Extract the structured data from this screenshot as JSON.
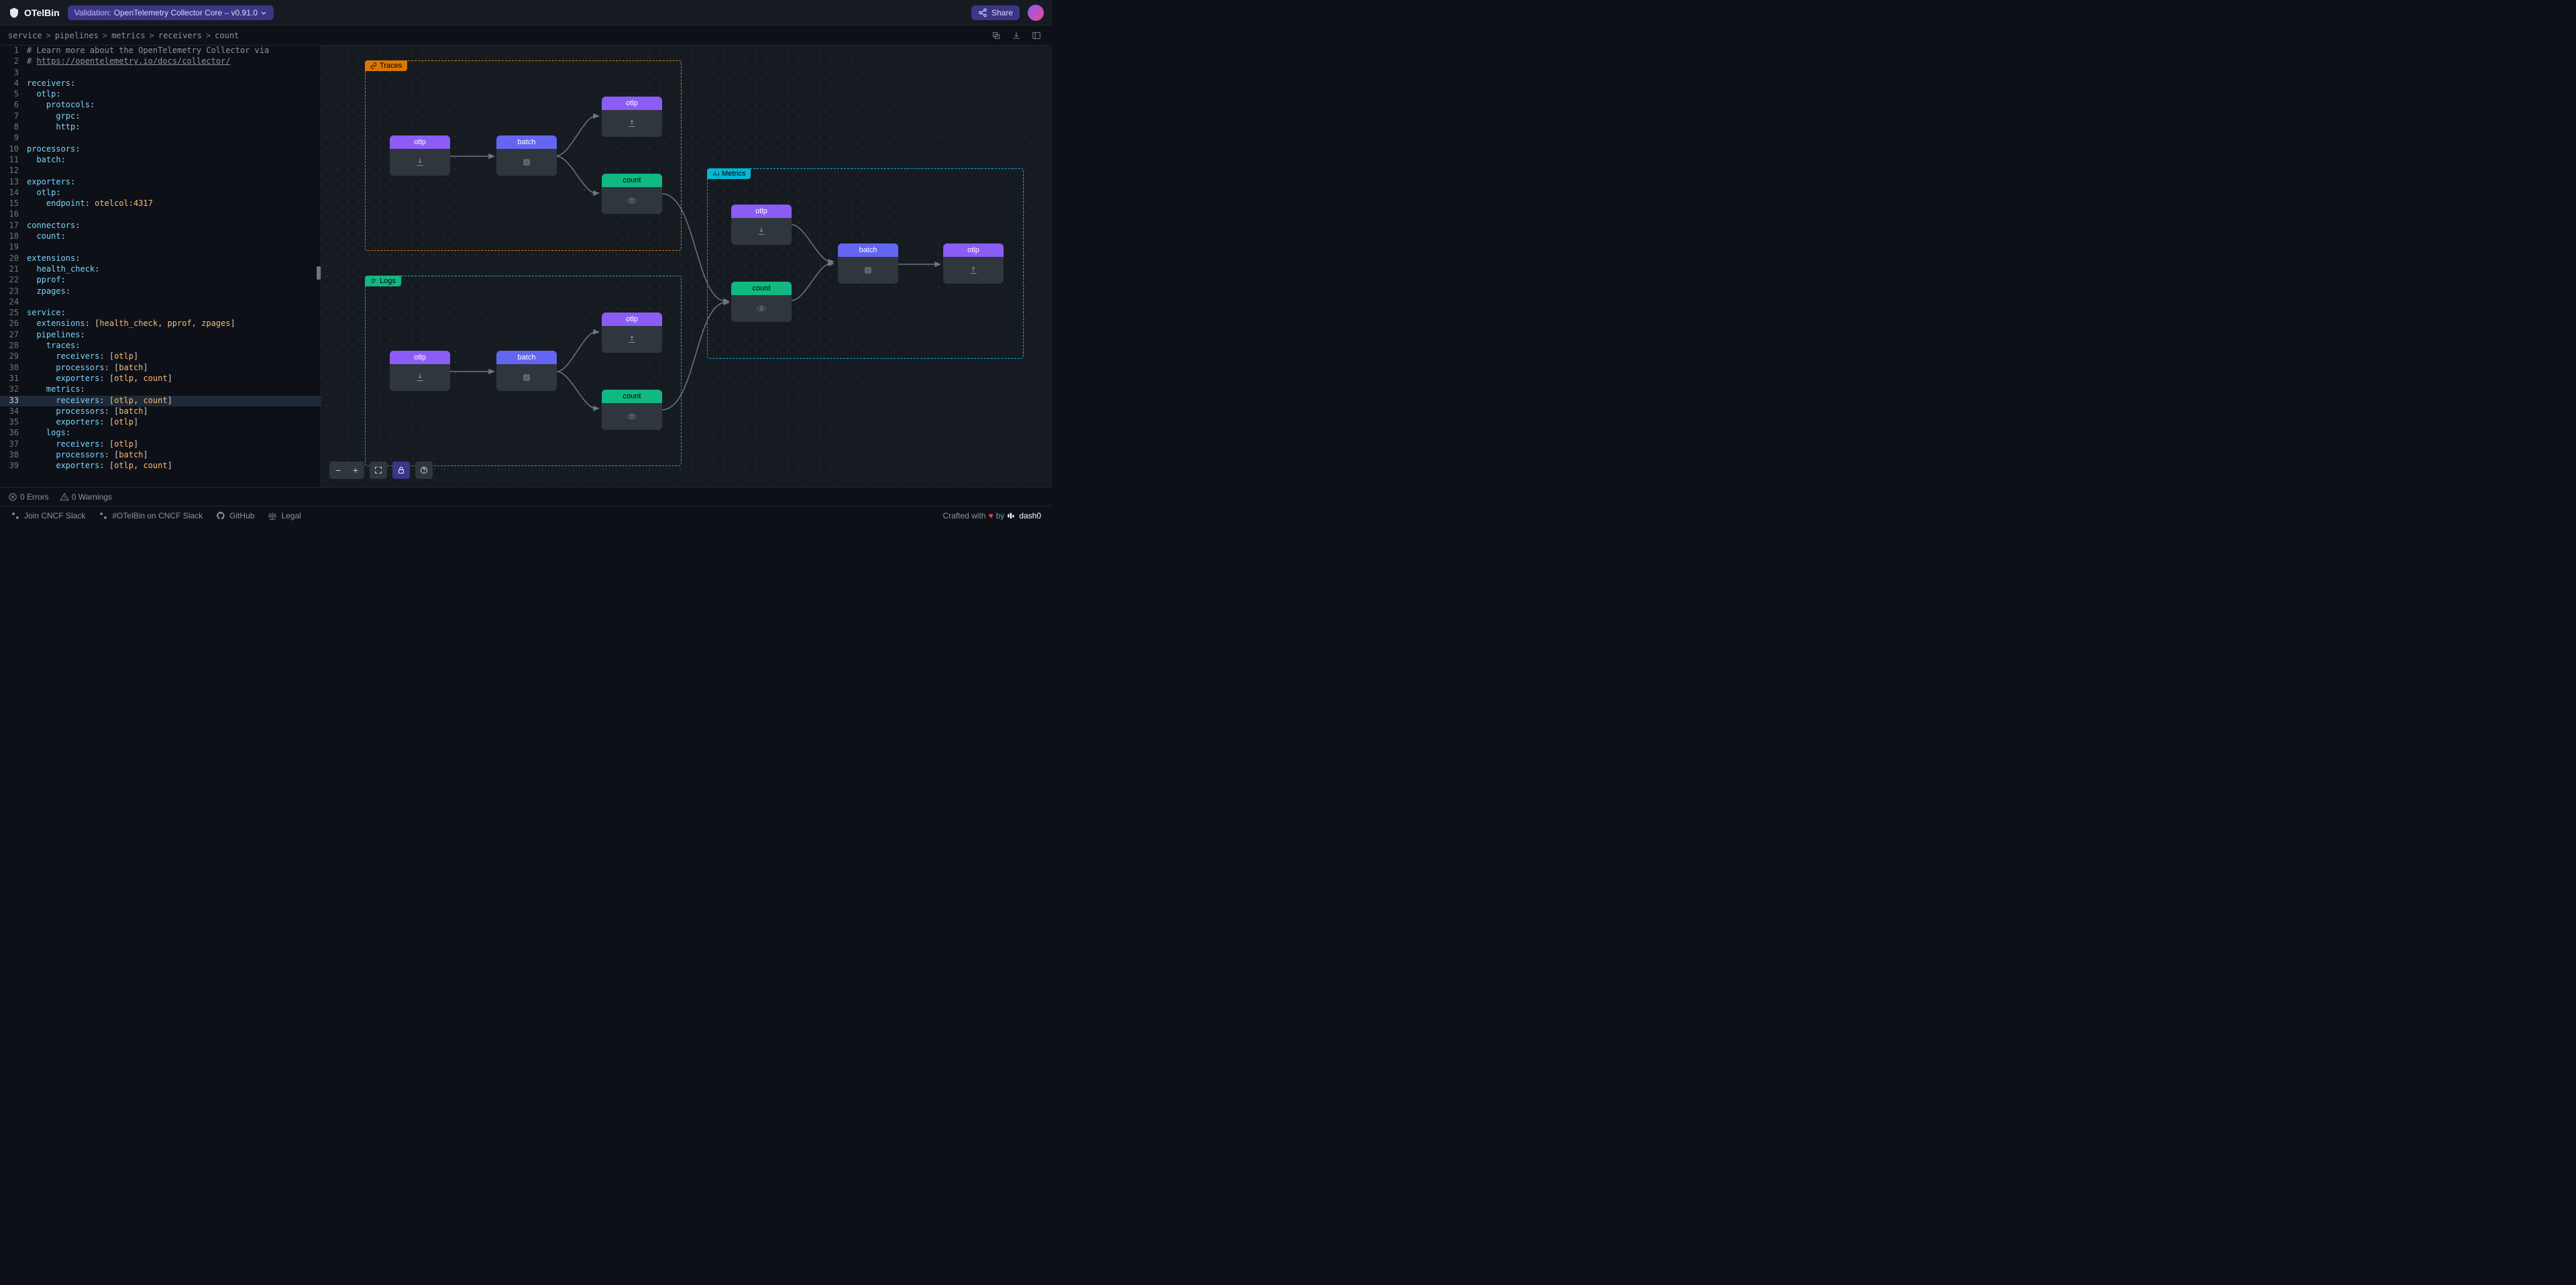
{
  "app": {
    "name": "OTelBin"
  },
  "header": {
    "validation_label": "Validation:",
    "validation_value": "OpenTelemetry Collector Core – v0.91.0",
    "share": "Share"
  },
  "breadcrumb": [
    "service",
    "pipelines",
    "metrics",
    "receivers",
    "count"
  ],
  "editor_lines": [
    {
      "n": 1,
      "type": "comment",
      "text": "# Learn more about the OpenTelemetry Collector via"
    },
    {
      "n": 2,
      "type": "comment-link",
      "prefix": "# ",
      "link": "https://opentelemetry.io/docs/collector/"
    },
    {
      "n": 3,
      "type": "blank",
      "text": ""
    },
    {
      "n": 4,
      "type": "kv",
      "indent": 0,
      "key": "receivers",
      "after": ":"
    },
    {
      "n": 5,
      "type": "kv",
      "indent": 1,
      "key": "otlp",
      "after": ":"
    },
    {
      "n": 6,
      "type": "kv",
      "indent": 2,
      "key": "protocols",
      "after": ":"
    },
    {
      "n": 7,
      "type": "kv",
      "indent": 3,
      "key": "grpc",
      "after": ":"
    },
    {
      "n": 8,
      "type": "kv",
      "indent": 3,
      "key": "http",
      "after": ":"
    },
    {
      "n": 9,
      "type": "blank",
      "text": ""
    },
    {
      "n": 10,
      "type": "kv",
      "indent": 0,
      "key": "processors",
      "after": ":"
    },
    {
      "n": 11,
      "type": "kv",
      "indent": 1,
      "key": "batch",
      "after": ":"
    },
    {
      "n": 12,
      "type": "blank",
      "text": ""
    },
    {
      "n": 13,
      "type": "kv",
      "indent": 0,
      "key": "exporters",
      "after": ":"
    },
    {
      "n": 14,
      "type": "kv",
      "indent": 1,
      "key": "otlp",
      "after": ":"
    },
    {
      "n": 15,
      "type": "kv-str",
      "indent": 2,
      "key": "endpoint",
      "value": "otelcol:4317"
    },
    {
      "n": 16,
      "type": "blank",
      "text": ""
    },
    {
      "n": 17,
      "type": "kv",
      "indent": 0,
      "key": "connectors",
      "after": ":"
    },
    {
      "n": 18,
      "type": "kv",
      "indent": 1,
      "key": "count",
      "after": ":"
    },
    {
      "n": 19,
      "type": "blank",
      "text": ""
    },
    {
      "n": 20,
      "type": "kv",
      "indent": 0,
      "key": "extensions",
      "after": ":"
    },
    {
      "n": 21,
      "type": "kv",
      "indent": 1,
      "key": "health_check",
      "after": ":"
    },
    {
      "n": 22,
      "type": "kv",
      "indent": 1,
      "key": "pprof",
      "after": ":"
    },
    {
      "n": 23,
      "type": "kv",
      "indent": 1,
      "key": "zpages",
      "after": ":"
    },
    {
      "n": 24,
      "type": "blank",
      "text": ""
    },
    {
      "n": 25,
      "type": "kv",
      "indent": 0,
      "key": "service",
      "after": ":"
    },
    {
      "n": 26,
      "type": "kv-list",
      "indent": 1,
      "key": "extensions",
      "items": [
        "health_check",
        "pprof",
        "zpages"
      ]
    },
    {
      "n": 27,
      "type": "kv",
      "indent": 1,
      "key": "pipelines",
      "after": ":"
    },
    {
      "n": 28,
      "type": "kv",
      "indent": 2,
      "key": "traces",
      "after": ":"
    },
    {
      "n": 29,
      "type": "kv-list",
      "indent": 3,
      "key": "receivers",
      "items": [
        "otlp"
      ]
    },
    {
      "n": 30,
      "type": "kv-list",
      "indent": 3,
      "key": "processors",
      "items": [
        "batch"
      ]
    },
    {
      "n": 31,
      "type": "kv-list",
      "indent": 3,
      "key": "exporters",
      "items": [
        "otlp",
        "count"
      ]
    },
    {
      "n": 32,
      "type": "kv",
      "indent": 2,
      "key": "metrics",
      "after": ":"
    },
    {
      "n": 33,
      "type": "kv-list",
      "indent": 3,
      "key": "receivers",
      "items": [
        "otlp",
        "count"
      ],
      "current": true
    },
    {
      "n": 34,
      "type": "kv-list",
      "indent": 3,
      "key": "processors",
      "items": [
        "batch"
      ]
    },
    {
      "n": 35,
      "type": "kv-list",
      "indent": 3,
      "key": "exporters",
      "items": [
        "otlp"
      ]
    },
    {
      "n": 36,
      "type": "kv",
      "indent": 2,
      "key": "logs",
      "after": ":"
    },
    {
      "n": 37,
      "type": "kv-list",
      "indent": 3,
      "key": "receivers",
      "items": [
        "otlp"
      ]
    },
    {
      "n": 38,
      "type": "kv-list",
      "indent": 3,
      "key": "processors",
      "items": [
        "batch"
      ]
    },
    {
      "n": 39,
      "type": "kv-list",
      "indent": 3,
      "key": "exporters",
      "items": [
        "otlp",
        "count"
      ]
    }
  ],
  "pipelines": {
    "traces": {
      "label": "Traces"
    },
    "logs": {
      "label": "Logs"
    },
    "metrics": {
      "label": "Metrics"
    }
  },
  "nodes": {
    "otlp": "otlp",
    "batch": "batch",
    "count": "count"
  },
  "status": {
    "errors": "0 Errors",
    "warnings": "0 Warnings"
  },
  "footer": {
    "slack": "Join CNCF Slack",
    "slack_channel": "#OTelBin on CNCF Slack",
    "github": "GitHub",
    "legal": "Legal",
    "crafted": "Crafted with",
    "by": "by",
    "brand": "dash0"
  }
}
